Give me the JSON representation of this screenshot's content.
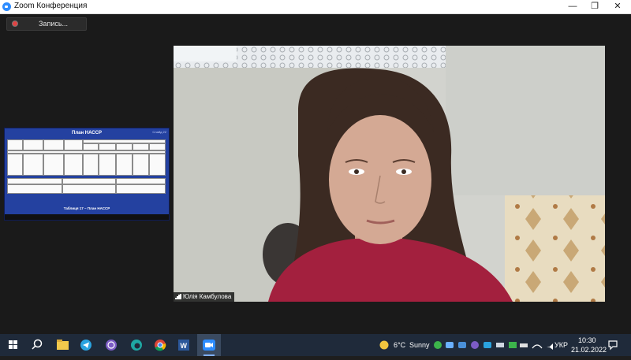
{
  "window": {
    "title": "Zoom Конференция",
    "minimize": "—",
    "restore": "❐",
    "close": "✕"
  },
  "recording": {
    "label": "Запись..."
  },
  "shared_screen": {
    "title": "План НАССР",
    "page_label": "Слайд 22",
    "caption": "Таблиця 17 – План НАССР"
  },
  "participant": {
    "name": "Юлія  Камбулова"
  },
  "taskbar": {
    "apps": [
      "start-icon",
      "search-icon",
      "file-explorer-icon",
      "telegram-icon",
      "viber-icon",
      "edge-icon",
      "chrome-icon",
      "word-icon",
      "zoom-icon"
    ],
    "active_app": "zoom-icon",
    "weather": {
      "temperature": "6°C",
      "condition": "Sunny"
    },
    "language": "УКР",
    "time": "10:30",
    "date": "21.02.2022"
  },
  "colors": {
    "zoom_blue": "#2d8cff",
    "taskbar": "#1f2a3a",
    "slide_blue": "#2441a0"
  }
}
